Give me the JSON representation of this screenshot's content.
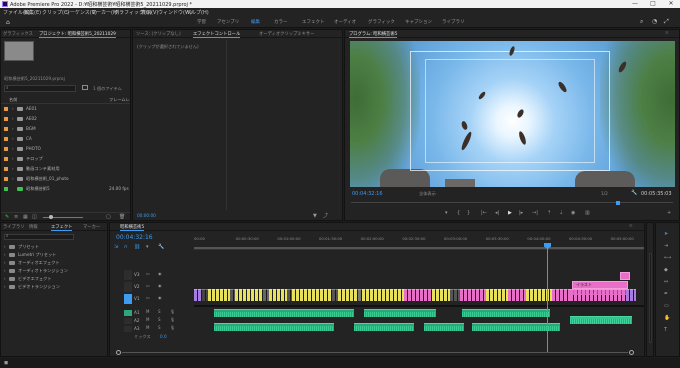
{
  "window": {
    "title": "Adobe Premiere Pro 2022 - D:¥昭和横芸術¥昭和横芸術5_20211029.prproj *",
    "controls": {
      "minimize": "—",
      "maximize": "□",
      "close": "✕"
    }
  },
  "menu": [
    "ファイル(F)",
    "編集(E)",
    "クリップ(C)",
    "シーケンス(S)",
    "マーカー(M)",
    "グラフィック(G)",
    "表示(V)",
    "ウィンドウ(W)",
    "ヘルプ(H)"
  ],
  "workspaces": [
    "学習",
    "アセンブリ",
    "編集",
    "カラー",
    "エフェクト",
    "オーディオ",
    "グラフィック",
    "キャプション",
    "ライブラリ"
  ],
  "workspace_active": "編集",
  "project_panel": {
    "tabs": [
      "プロジェクト: 昭和横芸術5_20211029",
      "メディアブラウザー"
    ],
    "caption_tab": "グラフィックス",
    "filename": "昭和横芸術5_20211029.prproj",
    "item_count": "1 個のアイテム",
    "column_name": "名前",
    "column_rate": "フレームレ",
    "items": [
      {
        "label": "AE01",
        "color": "#e89a3c",
        "type": "folder",
        "rate": ""
      },
      {
        "label": "AE02",
        "color": "#e89a3c",
        "type": "folder",
        "rate": ""
      },
      {
        "label": "BGM",
        "color": "#e89a3c",
        "type": "folder",
        "rate": ""
      },
      {
        "label": "CA",
        "color": "#e89a3c",
        "type": "folder",
        "rate": ""
      },
      {
        "label": "PHOTO",
        "color": "#e89a3c",
        "type": "folder",
        "rate": ""
      },
      {
        "label": "テロップ",
        "color": "#e89a3c",
        "type": "folder",
        "rate": ""
      },
      {
        "label": "動画コンテ素材用",
        "color": "#e89a3c",
        "type": "folder",
        "rate": ""
      },
      {
        "label": "昭和横芸術_01_photo",
        "color": "#e89a3c",
        "type": "folder",
        "rate": ""
      },
      {
        "label": "昭和横芸術5",
        "color": "#3cc24e",
        "type": "sequence",
        "rate": "24.00 fps"
      }
    ]
  },
  "effects_panel": {
    "tabs": [
      "ソース: (クリップなし)",
      "エフェクトコントロール",
      "オーディオクリップミキサー"
    ],
    "placeholder": "(クリップが選択されていません)",
    "timecode": "00:00:00"
  },
  "program_monitor": {
    "tab": "プログラム: 昭和横芸術5",
    "current_time": "00:04:32:16",
    "fit": "全体表示",
    "quality": "1/2",
    "duration": "00:05:35:03"
  },
  "effects_browser": {
    "tabs": [
      "ライブラリ",
      "情報",
      "エフェクト",
      "マーカー"
    ],
    "items": [
      "プリセット",
      "Lumetri プリセット",
      "オーディオエフェクト",
      "オーディオトランジション",
      "ビデオエフェクト",
      "ビデオトランジション"
    ]
  },
  "timeline": {
    "tab": "昭和横芸術5",
    "timecode": "00:04:32:16",
    "ruler": [
      "00:00",
      "00:00:30:00",
      "00:01:00:00",
      "00:01:30:00",
      "00:02:00:00",
      "00:02:30:00",
      "00:03:00:00",
      "00:03:30:00",
      "00:04:00:00",
      "00:04:30:00",
      "00:05:00:00"
    ],
    "video_tracks": [
      "V3",
      "V2",
      "V1"
    ],
    "audio_tracks": [
      "A1",
      "A2",
      "A3"
    ],
    "mix_label": "ミックス",
    "mix_value": "0.0",
    "title_clip_a": "イラスト",
    "title_clip_b": "ロゴ mp4",
    "colors": {
      "accent": "#3d9bf0",
      "playhead": "#3d9bf0",
      "audio": "#2aa879",
      "video_yellow": "#e7e05a",
      "video_pink": "#e86fc8",
      "video_purple": "#a77be0"
    }
  }
}
